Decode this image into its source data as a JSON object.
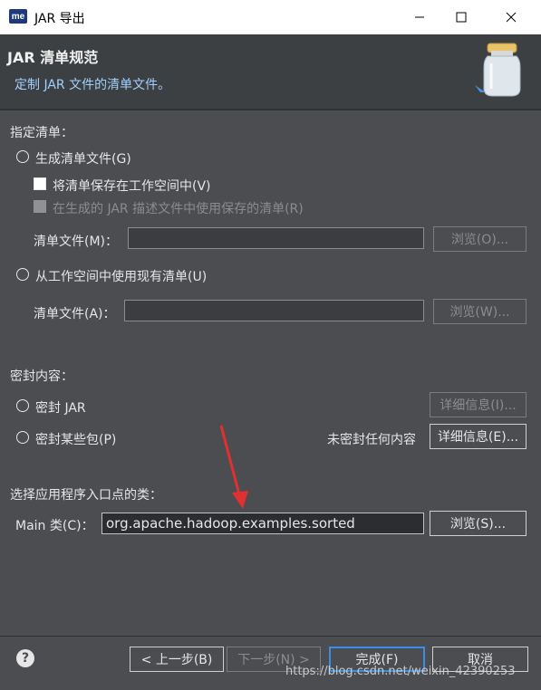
{
  "window": {
    "app_icon_text": "me",
    "title": "JAR 导出"
  },
  "header": {
    "title": "JAR 清单规范",
    "description": "定制 JAR 文件的清单文件。"
  },
  "manifest": {
    "section_label": "指定清单：",
    "generate_label": "生成清单文件(G)",
    "save_in_workspace_label": "将清单保存在工作空间中(V)",
    "reuse_saved_label": "在生成的 JAR 描述文件中使用保存的清单(R)",
    "manifest_file_label_1": "清单文件(M)：",
    "manifest_file_value_1": "",
    "browse_1_label": "浏览(O)...",
    "use_existing_label": "从工作空间中使用现有清单(U)",
    "manifest_file_label_2": "清单文件(A)：",
    "manifest_file_value_2": "",
    "browse_2_label": "浏览(W)..."
  },
  "seal": {
    "section_label": "密封内容：",
    "seal_jar_label": "密封 JAR",
    "details_1_label": "详细信息(I)...",
    "seal_some_label": "密封某些包(P)",
    "status_text": "未密封任何内容",
    "details_2_label": "详细信息(E)..."
  },
  "main_class": {
    "section_label": "选择应用程序入口点的类：",
    "label": "Main 类(C)：",
    "value": "org.apache.hadoop.examples.sorted",
    "browse_label": "浏览(S)..."
  },
  "footer": {
    "back_label": "< 上一步(B)",
    "next_label": "下一步(N) >",
    "finish_label": "完成(F)",
    "cancel_label": "取消"
  },
  "watermark": "https://blog.csdn.net/weixin_42390253",
  "colors": {
    "background": "#4b4d50",
    "header_bg": "#3d4043",
    "accent_blue": "#3a8ee6",
    "arrow_red": "#e03030"
  }
}
